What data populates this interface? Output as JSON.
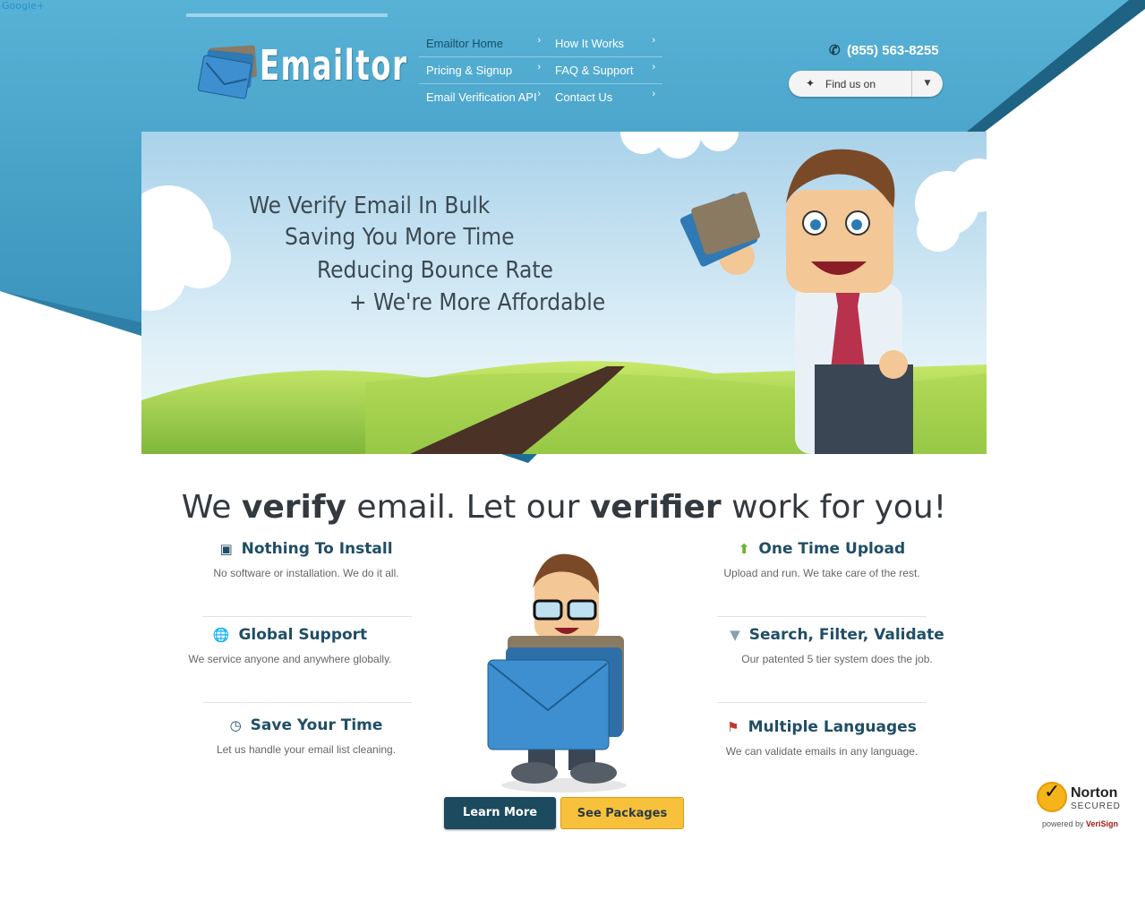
{
  "google_link": "Google+",
  "brand": {
    "name": "Emailtor"
  },
  "nav": {
    "items": [
      {
        "label": "Emailtor Home"
      },
      {
        "label": "How It Works"
      },
      {
        "label": "Pricing & Signup"
      },
      {
        "label": "FAQ & Support"
      },
      {
        "label": "Email Verification API"
      },
      {
        "label": "Contact Us"
      }
    ]
  },
  "contact": {
    "phone": "(855) 563-8255"
  },
  "find_us": {
    "label": "Find us on"
  },
  "hero": {
    "lines": [
      "We Verify Email In Bulk",
      "Saving You More Time",
      "Reducing Bounce Rate",
      "+ We're More Affordable"
    ]
  },
  "tagline": {
    "part1": "We ",
    "bold1": "verify",
    "part2": " email. Let our ",
    "bold2": "verifier",
    "part3": " work for you!"
  },
  "features": {
    "nothing_to_install": {
      "title": "Nothing To Install",
      "desc": "No software or installation. We do it all.",
      "icon": "box-icon"
    },
    "global_support": {
      "title": "Global Support",
      "desc": "We service anyone and anywhere globally.",
      "icon": "globe-icon"
    },
    "save_your_time": {
      "title": "Save Your Time",
      "desc": "Let us handle your email list cleaning.",
      "icon": "clock-icon"
    },
    "one_time_upload": {
      "title": "One Time Upload",
      "desc": "Upload and run. We take care of the rest.",
      "icon": "upload-arrow-icon"
    },
    "search_filter_validate": {
      "title": "Search, Filter, Validate",
      "desc": "Our patented 5 tier system does the job.",
      "icon": "funnel-icon"
    },
    "multiple_languages": {
      "title": "Multiple Languages",
      "desc": "We can validate emails in any language.",
      "icon": "flag-icon"
    }
  },
  "buttons": {
    "learn_more": "Learn More",
    "see_packages": "See Packages"
  },
  "norton": {
    "brand": "Norton",
    "secured": "SECURED",
    "powered_prefix": "powered by ",
    "powered_by": "VeriSign"
  },
  "colors": {
    "header_blue": "#4aa3c9",
    "nav_current": "#174f6a",
    "title_navy": "#1f4e66",
    "btn_primary": "#1c4a5e",
    "btn_secondary": "#f8c13c"
  }
}
